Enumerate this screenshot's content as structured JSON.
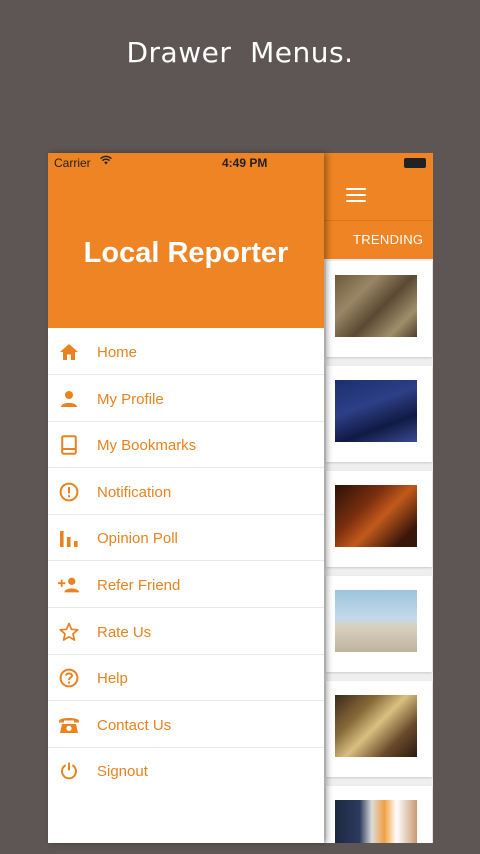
{
  "caption": "Drawer  Menus.",
  "status_bar": {
    "carrier": "Carrier",
    "time": "4:49 PM"
  },
  "drawer": {
    "title": "Local Reporter",
    "items": [
      {
        "label": "Home",
        "icon": "home-icon"
      },
      {
        "label": "My Profile",
        "icon": "person-icon"
      },
      {
        "label": "My Bookmarks",
        "icon": "bookmark-icon"
      },
      {
        "label": "Notification",
        "icon": "alert-circle-icon"
      },
      {
        "label": "Opinion Poll",
        "icon": "bar-chart-icon"
      },
      {
        "label": "Refer Friend",
        "icon": "add-person-icon"
      },
      {
        "label": "Rate Us",
        "icon": "star-icon"
      },
      {
        "label": "Help",
        "icon": "help-circle-icon"
      },
      {
        "label": "Contact Us",
        "icon": "phone-icon"
      },
      {
        "label": "Signout",
        "icon": "power-icon"
      }
    ]
  },
  "app": {
    "tab": "TRENDING",
    "menu_icon": "hamburger-icon"
  },
  "colors": {
    "accent": "#ee8424",
    "menu_text": "#e9821f",
    "backdrop": "#5d5654"
  }
}
